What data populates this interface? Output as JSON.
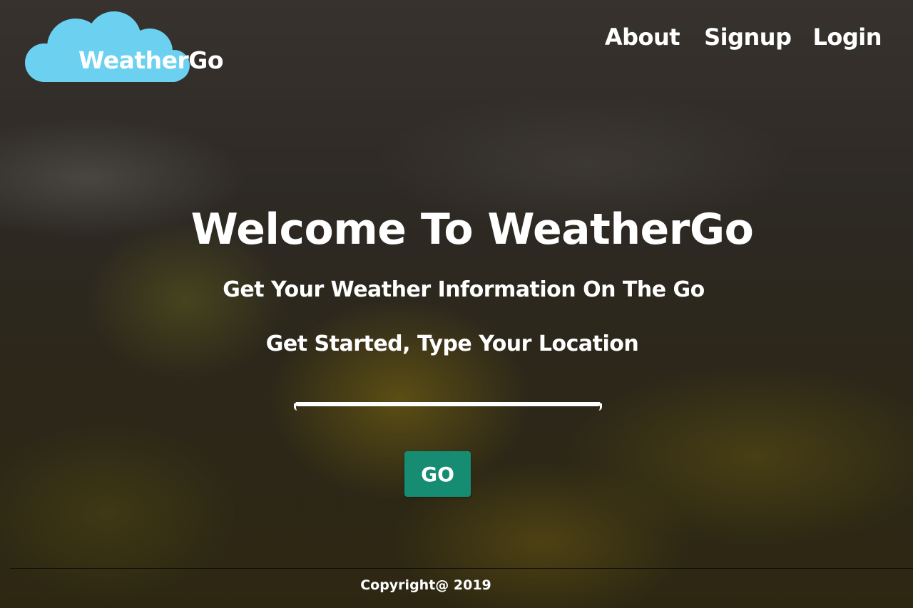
{
  "brand": {
    "name": "WeatherGo",
    "logo_icon": "cloud-icon",
    "logo_color": "#6cd0f0"
  },
  "nav": {
    "about": "About",
    "signup": "Signup",
    "login": "Login"
  },
  "hero": {
    "title": "Welcome To WeatherGo",
    "subtitle": "Get Your Weather Information On The Go",
    "prompt": "Get Started, Type Your Location"
  },
  "search": {
    "value": "",
    "placeholder": "",
    "button_label": "GO",
    "button_color": "#168c72"
  },
  "footer": {
    "copyright": "Copyright@ 2019"
  }
}
